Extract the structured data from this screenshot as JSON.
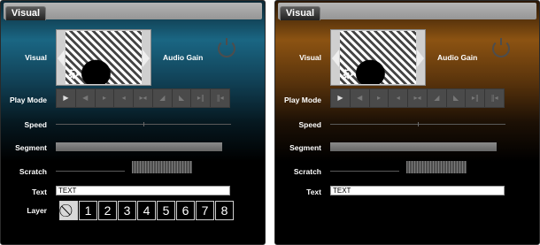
{
  "panels": [
    {
      "id": "blue",
      "tab_label": "Visual",
      "visual_label": "Visual",
      "audio_gain_label": "Audio Gain",
      "play_mode_label": "Play Mode",
      "speed_label": "Speed",
      "segment_label": "Segment",
      "scratch_label": "Scratch",
      "text_label": "Text",
      "layer_label": "Layer",
      "text_value": "TEXT",
      "accent_color": "#1a6683"
    },
    {
      "id": "brown",
      "tab_label": "Visual",
      "visual_label": "Visual",
      "audio_gain_label": "Audio Gain",
      "play_mode_label": "Play Mode",
      "speed_label": "Speed",
      "segment_label": "Segment",
      "scratch_label": "Scratch",
      "text_label": "Text",
      "layer_label": "Layer",
      "text_value": "TEXT",
      "accent_color": "#8c5312"
    }
  ],
  "play_mode_buttons": [
    {
      "icon": "bracket-right-icon",
      "glyph": "▶"
    },
    {
      "icon": "bracket-left-icon",
      "glyph": "◀"
    },
    {
      "icon": "play-icon",
      "glyph": "▸"
    },
    {
      "icon": "reverse-icon",
      "glyph": "◂"
    },
    {
      "icon": "ping-pong-icon",
      "glyph": "▸◂"
    },
    {
      "icon": "ramp-forward-icon",
      "glyph": "◢"
    },
    {
      "icon": "ramp-reverse-icon",
      "glyph": "◣"
    },
    {
      "icon": "play-pause-icon",
      "glyph": "▸‖"
    },
    {
      "icon": "reverse-pause-icon",
      "glyph": "‖◂"
    }
  ],
  "layer_buttons": [
    "⃠",
    "1",
    "2",
    "3",
    "4",
    "5",
    "6",
    "7",
    "8"
  ]
}
